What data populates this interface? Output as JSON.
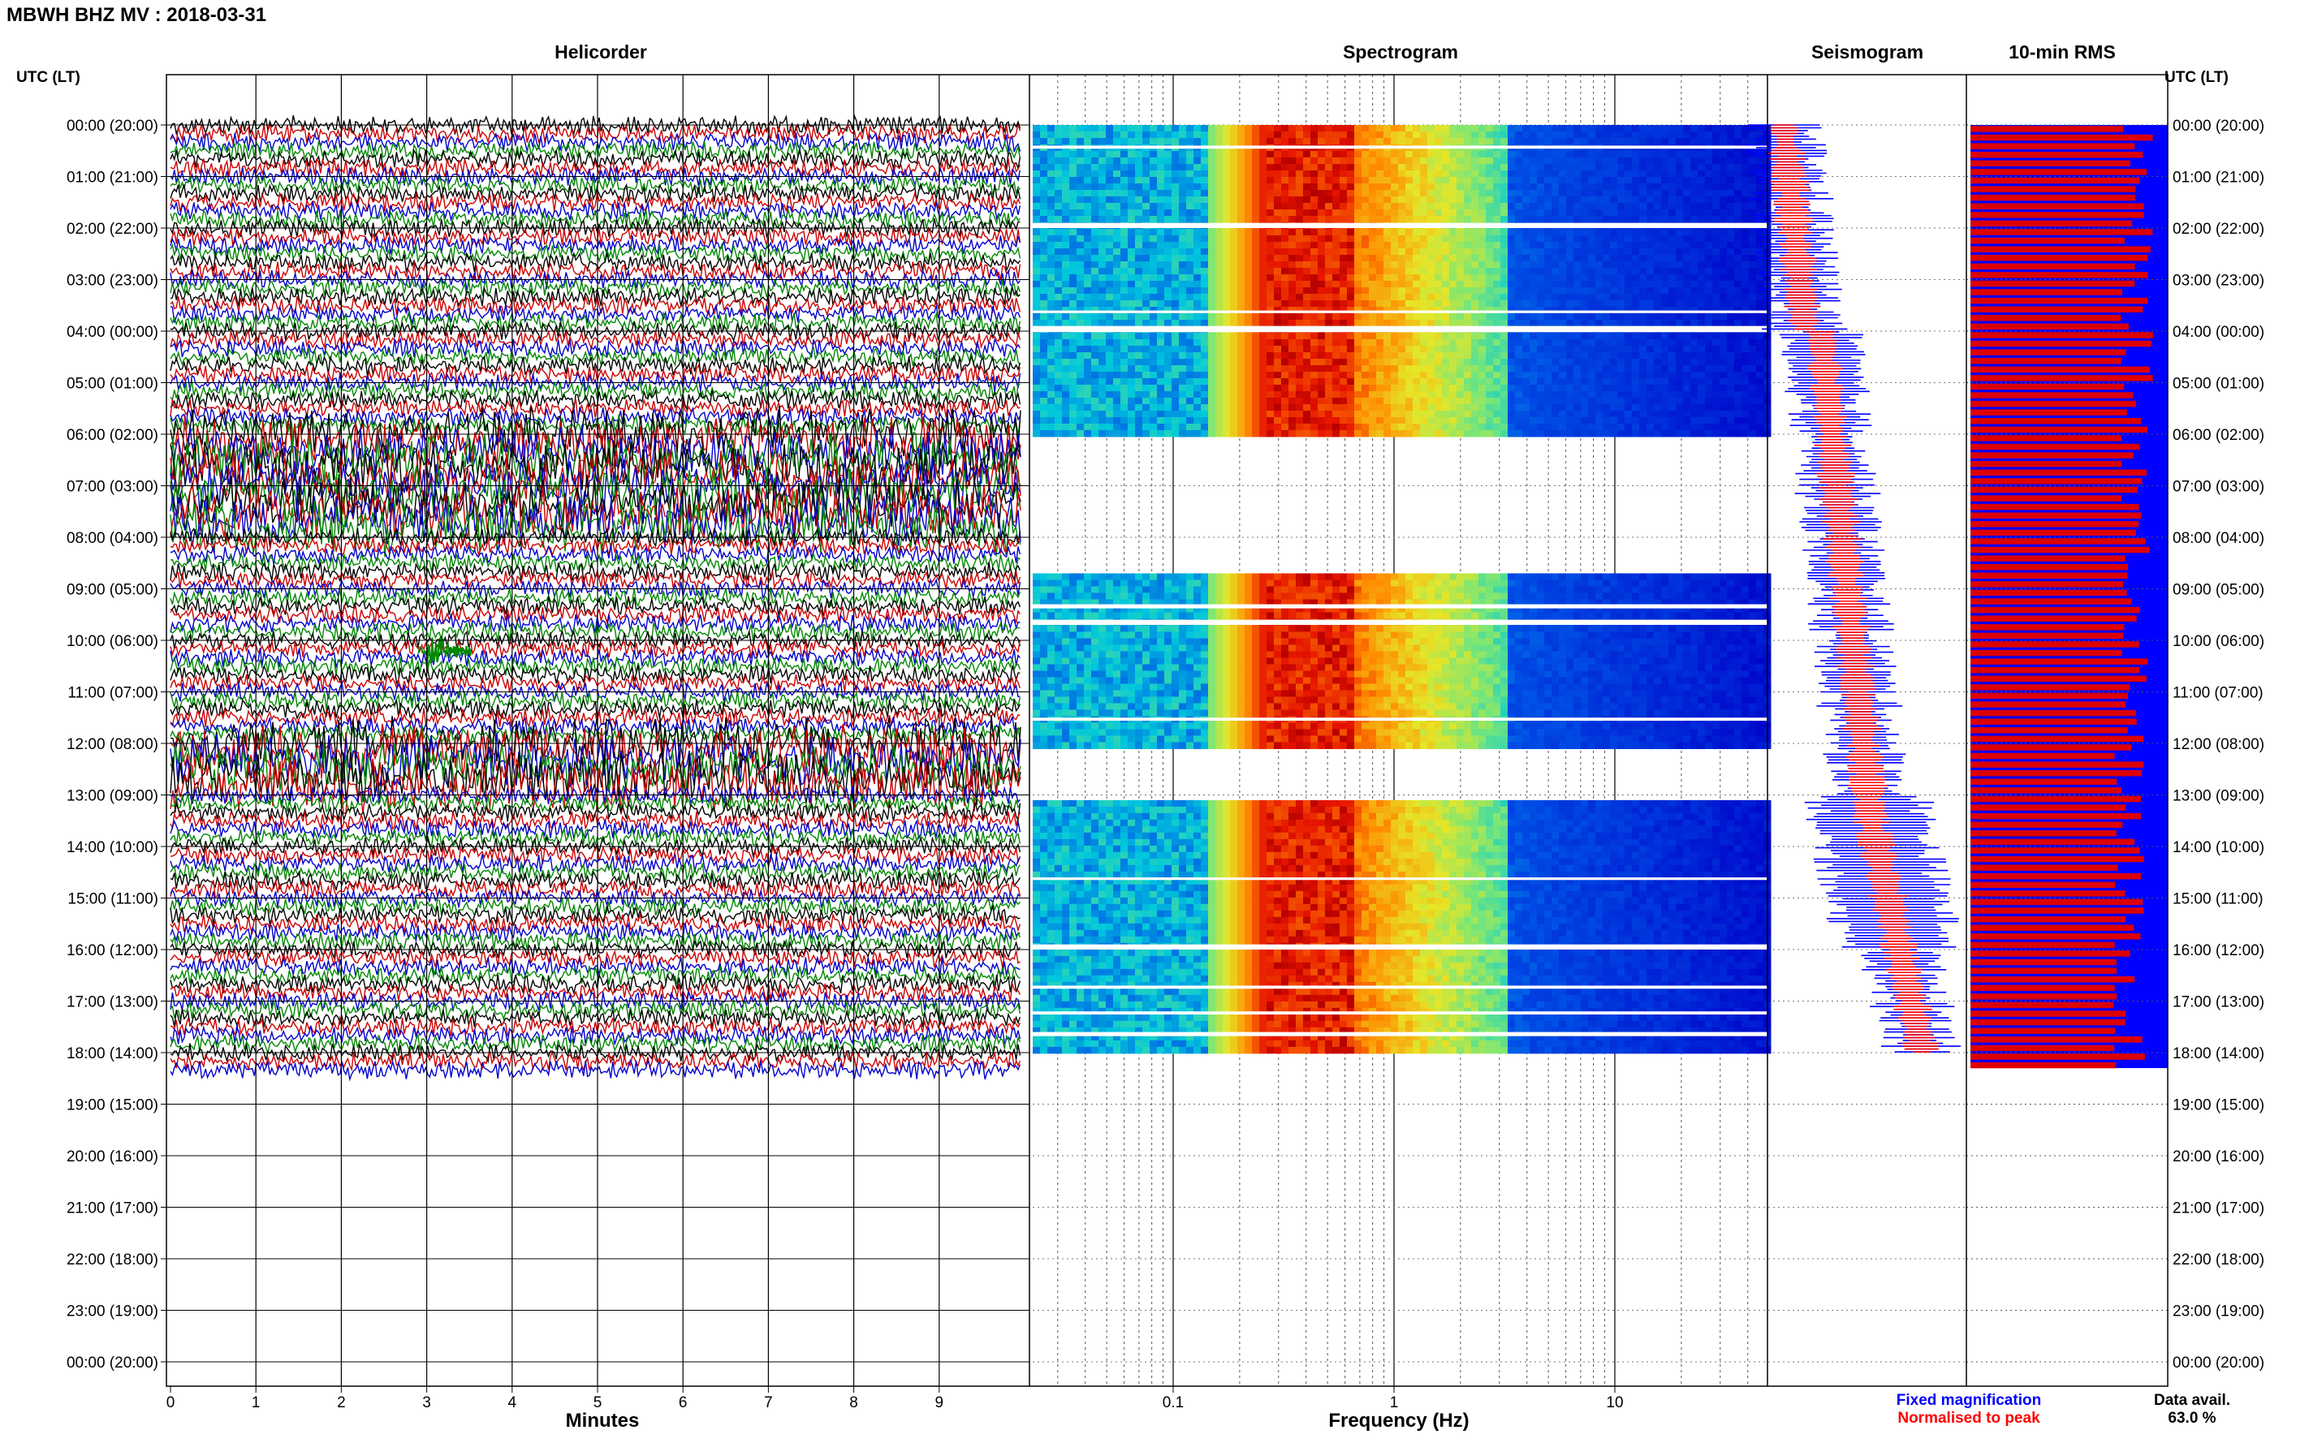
{
  "header": {
    "title": "MBWH BHZ MV : 2018-03-31"
  },
  "panels": {
    "helicorder": "Helicorder",
    "spectrogram": "Spectrogram",
    "seismogram": "Seismogram",
    "rms": "10-min RMS"
  },
  "axis_labels": {
    "left_time": "UTC (LT)",
    "right_time": "UTC (LT)",
    "minutes": "Minutes",
    "frequency": "Frequency (Hz)"
  },
  "legend": {
    "fixed": "Fixed magnification",
    "fixed_color": "#0000ff",
    "normalised": "Normalised to peak",
    "normalised_color": "#ff0000"
  },
  "data_avail": {
    "label": "Data avail.",
    "value": "63.0 %"
  },
  "colors": {
    "trace_colors": [
      "#000000",
      "#cc0000",
      "#0000cc",
      "#008800"
    ],
    "rms_fixed": "#0000ff",
    "rms_normalised": "#dd0000"
  },
  "chart_data": [
    {
      "type": "line",
      "title": "Helicorder",
      "xlabel": "Minutes",
      "ylabel": "UTC (LT)",
      "x_ticks": [
        "0",
        "1",
        "2",
        "3",
        "4",
        "5",
        "6",
        "7",
        "8",
        "9"
      ],
      "xlim": [
        0,
        10
      ],
      "y_ticks_left": [
        "00:00 (20:00)",
        "01:00 (21:00)",
        "02:00 (22:00)",
        "03:00 (23:00)",
        "04:00 (00:00)",
        "05:00 (01:00)",
        "06:00 (02:00)",
        "07:00 (03:00)",
        "08:00 (04:00)",
        "09:00 (05:00)",
        "10:00 (06:00)",
        "11:00 (07:00)",
        "12:00 (08:00)",
        "13:00 (09:00)",
        "14:00 (10:00)",
        "15:00 (11:00)",
        "16:00 (12:00)",
        "17:00 (13:00)",
        "18:00 (14:00)",
        "19:00 (15:00)",
        "20:00 (16:00)",
        "21:00 (17:00)",
        "22:00 (18:00)",
        "23:00 (19:00)",
        "00:00 (20:00)"
      ],
      "data_coverage_hours": [
        0,
        18.3
      ],
      "noisy_intervals_hours": [
        [
          6,
          8
        ],
        [
          12,
          13
        ]
      ],
      "event_time_hours": 10.2,
      "event_minute": 3
    },
    {
      "type": "heatmap",
      "title": "Spectrogram",
      "xlabel": "Frequency (Hz)",
      "x_scale": "log",
      "x_ticks": [
        "0.1",
        "1",
        "10"
      ],
      "xlim": [
        0.02,
        50
      ],
      "time_blocks_hours": [
        [
          0,
          6
        ],
        [
          8.7,
          12
        ],
        [
          13.1,
          18
        ]
      ],
      "dominant_band_hz": [
        0.15,
        0.5
      ]
    },
    {
      "type": "line",
      "title": "Seismogram",
      "series": [
        {
          "name": "Fixed magnification",
          "color": "#0000ff"
        },
        {
          "name": "Normalised to peak",
          "color": "#ff0000"
        }
      ]
    },
    {
      "type": "bar",
      "title": "10-min RMS",
      "orientation": "horizontal",
      "series": [
        {
          "name": "Fixed magnification",
          "color": "#0000ff"
        },
        {
          "name": "Normalised to peak",
          "color": "#dd0000"
        }
      ],
      "coverage_hours": [
        0,
        18.3
      ]
    }
  ]
}
